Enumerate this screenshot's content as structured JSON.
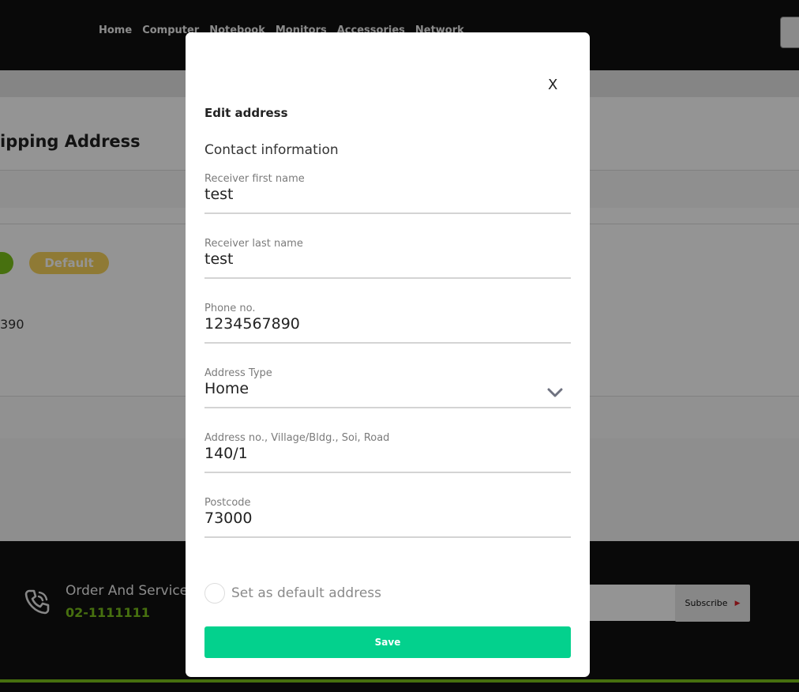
{
  "nav": {
    "links": [
      "Home",
      "Computer",
      "Notebook",
      "Monitors",
      "Accessories",
      "Network"
    ]
  },
  "page": {
    "title": "ipping Address",
    "default_badge": "Default",
    "phone_fragment": "390"
  },
  "footer": {
    "title": "Order And Service",
    "phone": "02-1111111",
    "subscribe_label": "Subscribe",
    "accent": "#7bc21b"
  },
  "modal": {
    "close_label": "X",
    "title": "Edit address",
    "section": "Contact information",
    "fields": [
      {
        "label": "Receiver first name",
        "value": "test"
      },
      {
        "label": "Receiver last name",
        "value": "test"
      },
      {
        "label": "Phone no.",
        "value": "1234567890"
      },
      {
        "label": "Address Type",
        "value": "Home",
        "icon": "chevron-down-icon"
      },
      {
        "label": "Address no., Village/Bldg., Soi, Road",
        "value": "140/1"
      },
      {
        "label": "Postcode",
        "value": "73000"
      }
    ],
    "default_checkbox_label": "Set as default address",
    "save_label": "Save",
    "save_color": "#03d18d"
  }
}
